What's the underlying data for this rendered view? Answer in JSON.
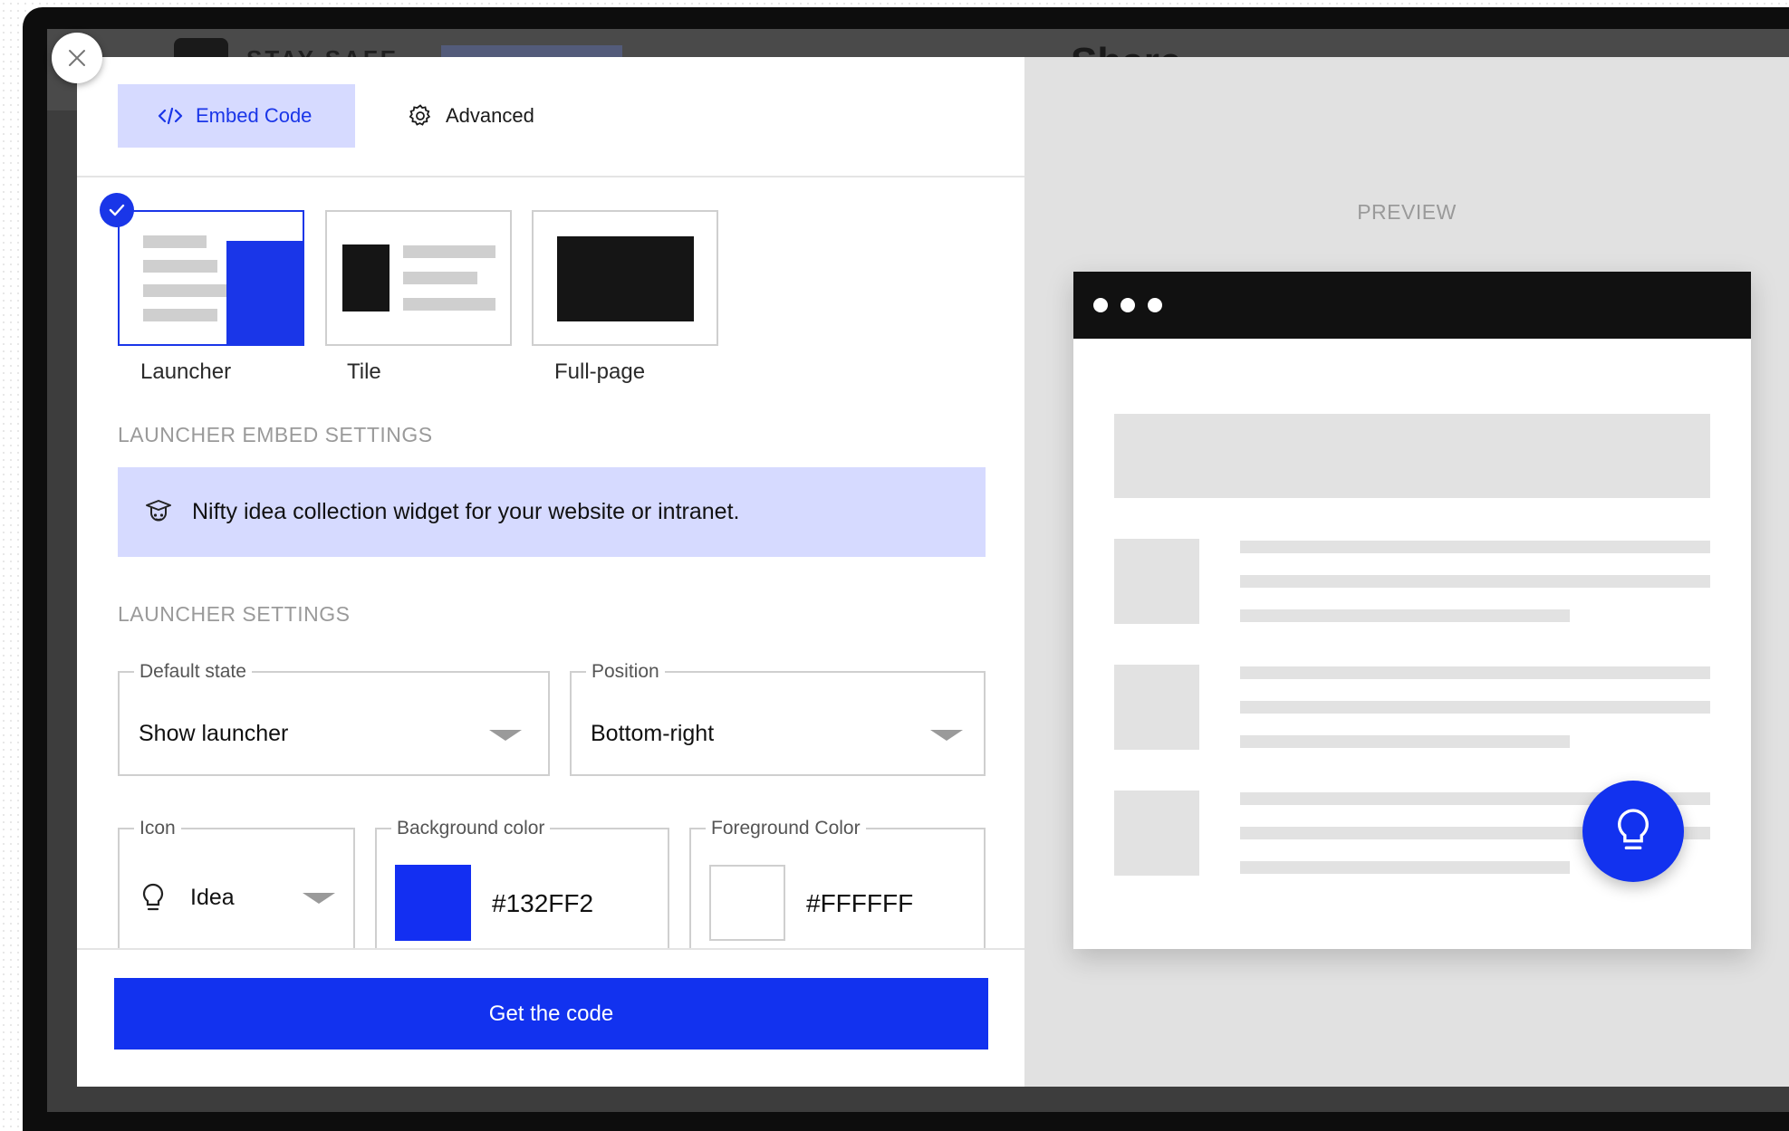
{
  "background_app": {
    "title": "STAY SAFE",
    "header": "Share"
  },
  "tabs": [
    {
      "label": "Embed Code",
      "icon": "code-icon",
      "active": true
    },
    {
      "label": "Advanced",
      "icon": "gear-icon",
      "active": false
    }
  ],
  "embed_types": [
    {
      "label": "Launcher",
      "selected": true
    },
    {
      "label": "Tile",
      "selected": false
    },
    {
      "label": "Full-page",
      "selected": false
    }
  ],
  "launcher_embed_settings": {
    "heading": "LAUNCHER EMBED SETTINGS",
    "banner_text": "Nifty idea collection widget for your website or intranet.",
    "banner_icon": "graduate-icon"
  },
  "launcher_settings": {
    "heading": "LAUNCHER SETTINGS",
    "default_state": {
      "label": "Default state",
      "value": "Show launcher"
    },
    "position": {
      "label": "Position",
      "value": "Bottom-right"
    },
    "icon": {
      "label": "Icon",
      "value": "Idea",
      "icon": "lightbulb-icon"
    },
    "background_color": {
      "label": "Background color",
      "value": "#132FF2"
    },
    "foreground_color": {
      "label": "Foreground Color",
      "value": "#FFFFFF"
    }
  },
  "cta_label": "Get the code",
  "preview": {
    "heading": "PREVIEW",
    "launcher_icon": "lightbulb-icon"
  },
  "colors": {
    "accent": "#1232EF",
    "tab_active_bg": "#D6DAFF"
  }
}
